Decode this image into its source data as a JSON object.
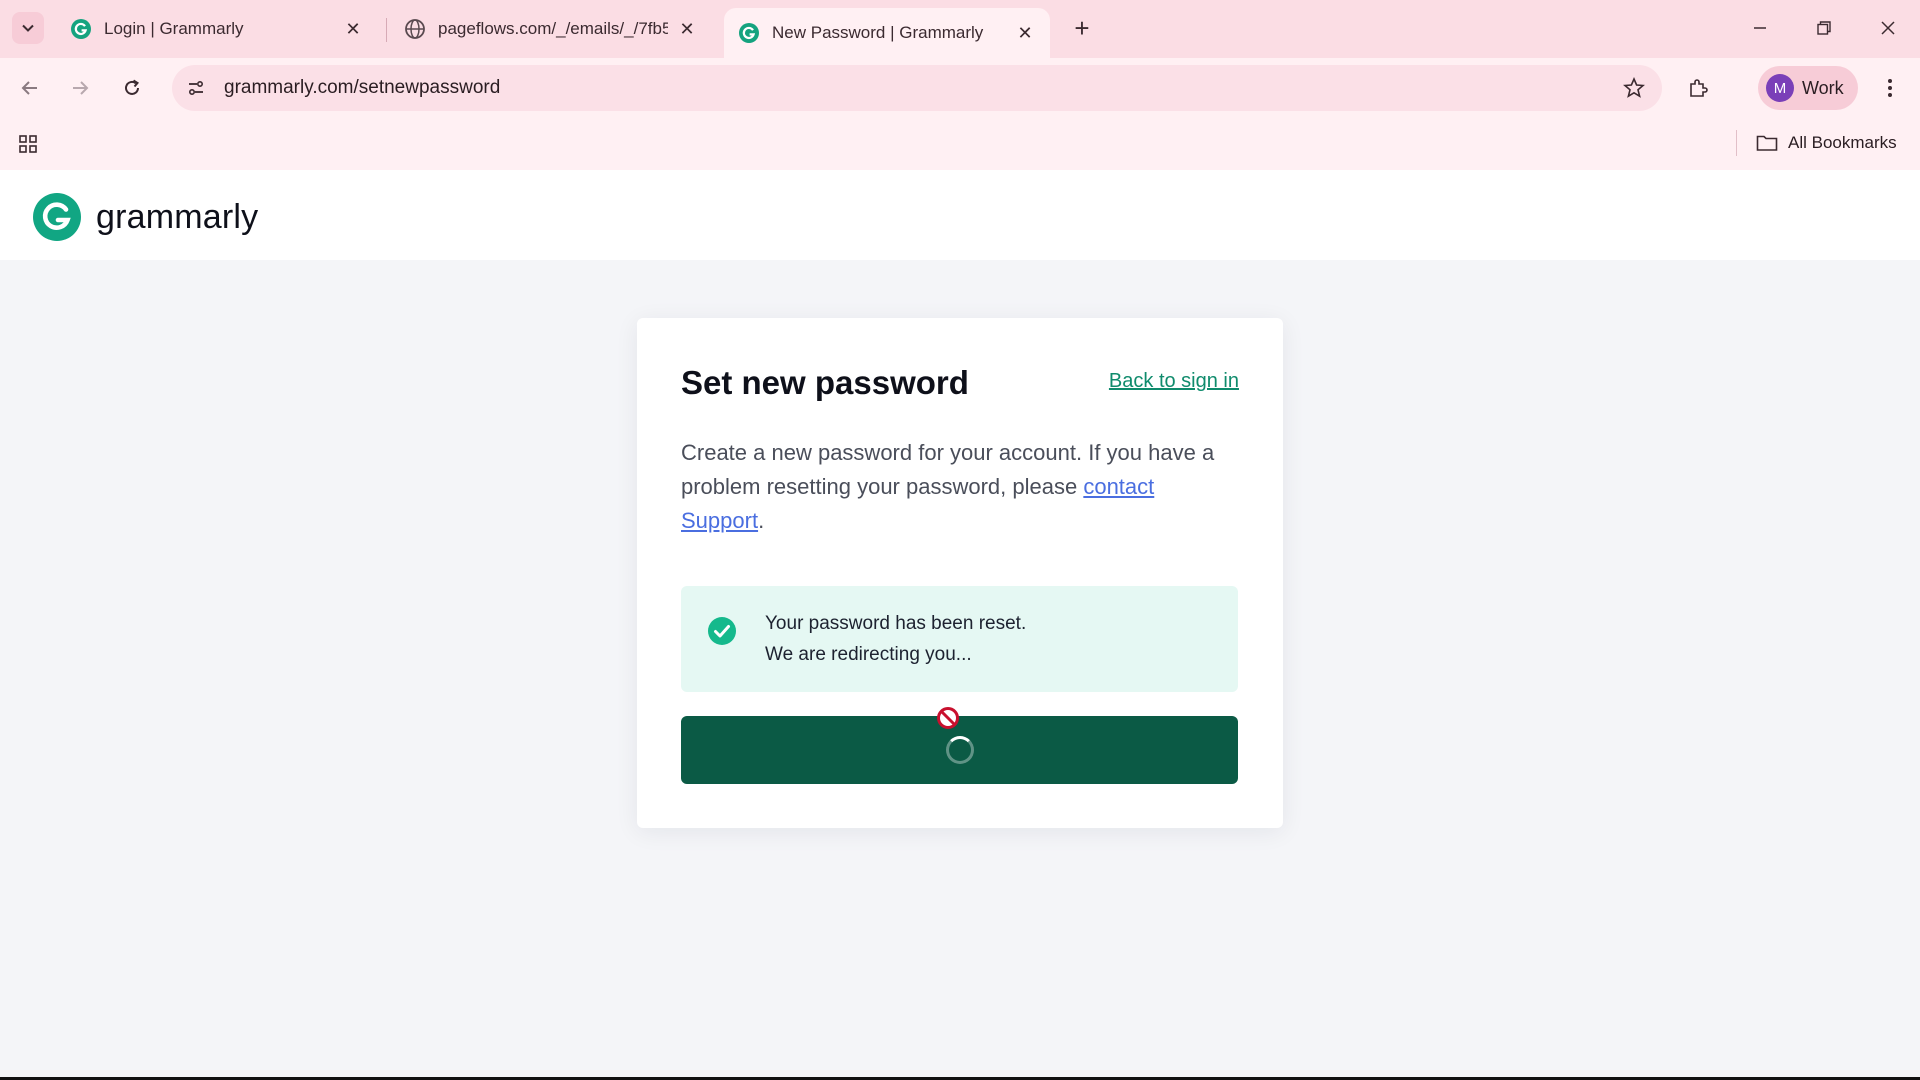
{
  "browser": {
    "tabs": [
      {
        "title": "Login | Grammarly",
        "active": false
      },
      {
        "title": "pageflows.com/_/emails/_/7fb5",
        "active": false
      },
      {
        "title": "New Password | Grammarly",
        "active": true
      }
    ],
    "url": "grammarly.com/setnewpassword",
    "profile": {
      "initial": "M",
      "name": "Work"
    },
    "bookmarks_label": "All Bookmarks"
  },
  "site": {
    "logo_text": "grammarly"
  },
  "card": {
    "title": "Set new password",
    "back_link": "Back to sign in",
    "description_prefix": "Create a new password for your account. If you have a problem resetting your password, please ",
    "contact_link": "contact Support",
    "description_suffix": ".",
    "alert_line1": "Your password has been reset.",
    "alert_line2": "We are redirecting you..."
  },
  "colors": {
    "chrome_bg": "#fbdde4",
    "brand_green": "#15c39a",
    "button_green": "#0b5a45",
    "alert_bg": "#e5f8f3"
  }
}
